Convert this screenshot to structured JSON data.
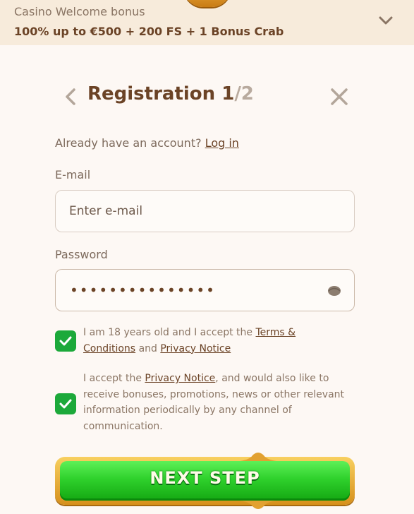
{
  "bonus": {
    "title": "Casino Welcome bonus",
    "offer": "100% up to €500 + 200 FS + 1 Bonus Crab"
  },
  "header": {
    "title": "Registration 1",
    "step_total": "/2"
  },
  "login_prompt": {
    "text": "Already have an account?",
    "link": "Log in"
  },
  "email": {
    "label": "E-mail",
    "placeholder": "Enter e-mail"
  },
  "password": {
    "label": "Password",
    "value_masked": "•••••••••••••••"
  },
  "consents": [
    {
      "checked": true,
      "prefix": "I am 18 years old and I accept the",
      "link1": "Terms & Conditions",
      "middle": "and",
      "link2": "Privacy Notice"
    },
    {
      "checked": true,
      "prefix": "I accept the",
      "link1": "Privacy Notice",
      "suffix": ", and would also like to receive bonuses, promotions, news or other relevant information periodically by any channel of communication."
    }
  ],
  "next_button": {
    "label": "NEXT STEP"
  },
  "colors": {
    "accent_brown": "#6b4326",
    "checkbox_green": "#1ca93a",
    "button_green": "#2fd12c",
    "button_gold": "#f8d060"
  }
}
